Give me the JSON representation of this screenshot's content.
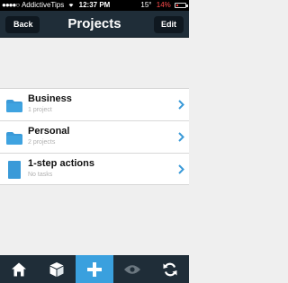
{
  "status_bar": {
    "carrier": "AddictiveTips",
    "time": "12:37 PM",
    "temperature": "15°",
    "battery": "14%",
    "signal": "●●●●○"
  },
  "nav": {
    "back_label": "Back",
    "title": "Projects",
    "edit_label": "Edit"
  },
  "projects": [
    {
      "title": "Business",
      "subtitle": "1 project",
      "icon": "folder-icon"
    },
    {
      "title": "Personal",
      "subtitle": "2 projects",
      "icon": "folder-icon"
    },
    {
      "title": "1-step actions",
      "subtitle": "No tasks",
      "icon": "task-list-icon"
    }
  ],
  "tabs": [
    {
      "name": "home",
      "icon": "home-icon"
    },
    {
      "name": "projects",
      "icon": "box-icon"
    },
    {
      "name": "add",
      "icon": "plus-icon",
      "active": true
    },
    {
      "name": "review",
      "icon": "eye-icon"
    },
    {
      "name": "sync",
      "icon": "sync-icon"
    }
  ],
  "colors": {
    "nav_bg": "#1f2d38",
    "accent": "#3aa0de",
    "chevron": "#3a9ad8",
    "background": "#efefef"
  }
}
